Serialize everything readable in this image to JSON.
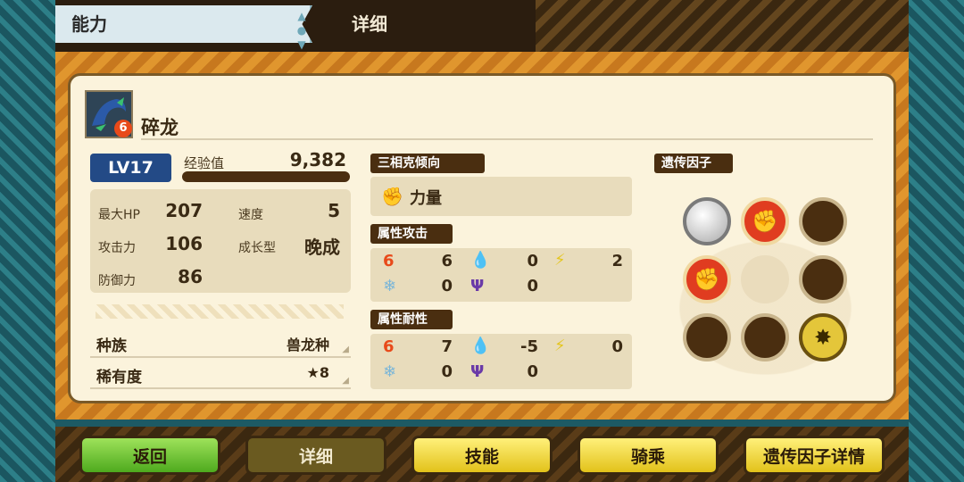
{
  "header": {
    "active_tab": "能力",
    "detail_label": "详细"
  },
  "monster": {
    "name": "碎龙",
    "badge_icon": "fire-element",
    "level": "LV17",
    "exp_label": "经验值",
    "exp_value": "9,382",
    "exp_fill_fraction": 1.0
  },
  "stats": {
    "max_hp_label": "最大HP",
    "max_hp": "207",
    "speed_label": "速度",
    "speed": "5",
    "attack_label": "攻击力",
    "attack": "106",
    "growth_label": "成长型",
    "growth": "晚成",
    "defense_label": "防御力",
    "defense": "86"
  },
  "info": {
    "species_label": "种族",
    "species": "兽龙种",
    "rarity_label": "稀有度",
    "rarity": "★8"
  },
  "tendency": {
    "header": "三相克倾向",
    "icon": "power-fist-icon",
    "value": "力量"
  },
  "attr_attack": {
    "header": "属性攻击",
    "fire": "6",
    "water": "0",
    "thunder": "2",
    "ice": "0",
    "dragon": "0"
  },
  "attr_resist": {
    "header": "属性耐性",
    "fire": "7",
    "water": "-5",
    "thunder": "0",
    "ice": "0",
    "dragon": "0"
  },
  "genes": {
    "header": "遗传因子",
    "slots": [
      "silver",
      "power",
      "empty",
      "power",
      "blank",
      "empty",
      "empty",
      "empty",
      "special"
    ]
  },
  "footer": {
    "back": "返回",
    "detail": "详细",
    "skills": "技能",
    "ride": "骑乘",
    "gene_detail": "遗传因子详情"
  },
  "colors": {
    "panel_bg": "#fbf3dc",
    "header_dark": "#4a2e10",
    "fire": "#e84a1a",
    "water": "#3a8fd0",
    "thunder": "#e4c620",
    "ice": "#7ab6d8",
    "dragon": "#6a3aa8"
  }
}
